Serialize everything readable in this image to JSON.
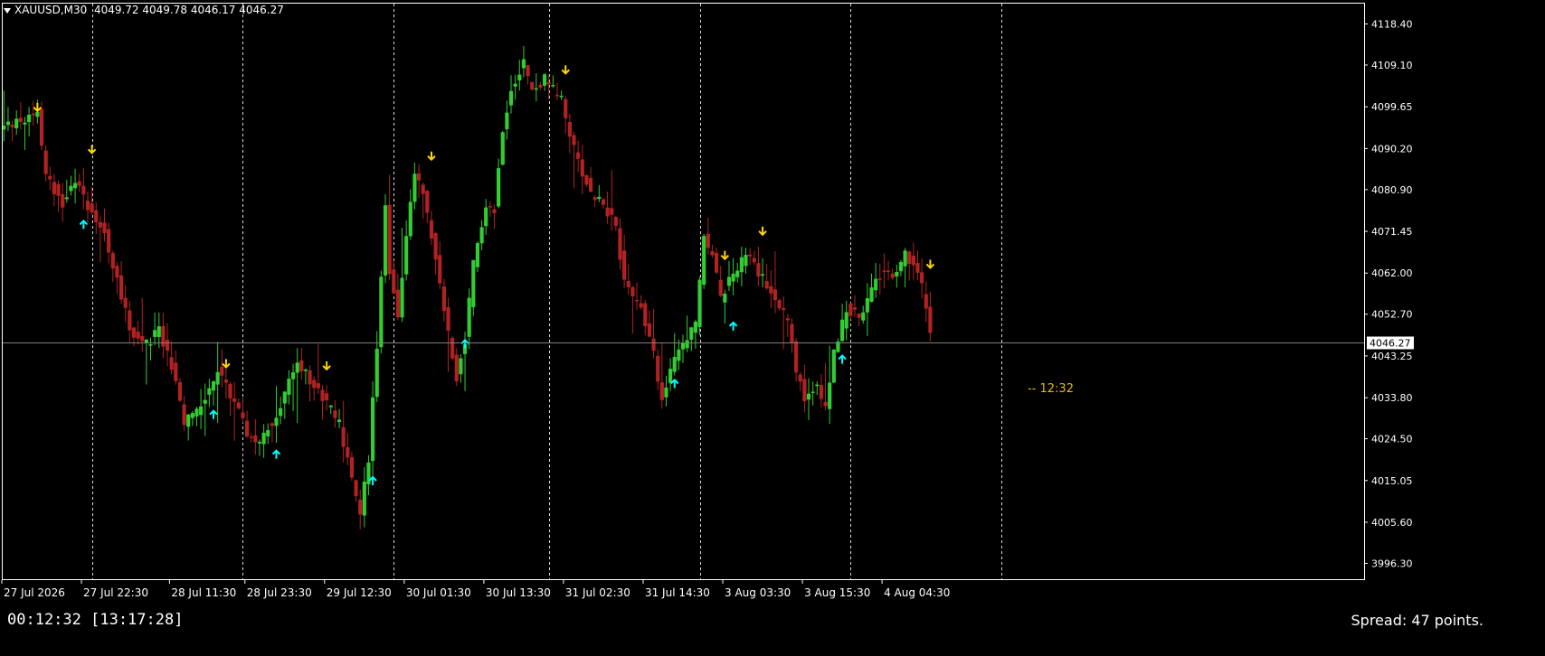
{
  "header": {
    "symbol": "XAUUSD,M30",
    "ohlc": "4049.72 4049.78 4046.17 4046.27"
  },
  "status": {
    "timer": "00:12:32 [13:17:28]",
    "spread": "Spread: 47 points.",
    "bar_countdown": "-- 12:32"
  },
  "colors": {
    "background": "#000000",
    "bull": "#32cd32",
    "bear": "#b22222",
    "grid": "#ffffff",
    "signal_sell": "#ffd700",
    "signal_buy": "#00ffff",
    "current_price_line": "#808080"
  },
  "chart_data": {
    "type": "candlestick",
    "title": "XAUUSD,M30",
    "xlabel": "",
    "ylabel": "",
    "ylim": [
      3992.5,
      4123.0
    ],
    "current_price": 4046.27,
    "current_price_label": "4046.27",
    "y_ticks": [
      "4118.40",
      "4109.10",
      "4099.65",
      "4090.20",
      "4080.90",
      "4071.45",
      "4062.00",
      "4052.70",
      "4043.25",
      "4033.80",
      "4024.50",
      "4015.05",
      "4005.60",
      "3996.30"
    ],
    "x_tick_labels": [
      "27 Jul 2026",
      "27 Jul 22:30",
      "28 Jul 11:30",
      "28 Jul 23:30",
      "29 Jul 12:30",
      "30 Jul 01:30",
      "30 Jul 13:30",
      "31 Jul 02:30",
      "31 Jul 14:30",
      "3 Aug 03:30",
      "3 Aug 15:30",
      "4 Aug 04:30"
    ],
    "x_tick_index": [
      0,
      19,
      40,
      58,
      77,
      96,
      115,
      134,
      153,
      172,
      191,
      210
    ],
    "period_separators_index": [
      21,
      57,
      93,
      130,
      166,
      202,
      238
    ],
    "total_slots": 325,
    "close_path": [
      [
        0,
        4095
      ],
      [
        8,
        4098
      ],
      [
        10,
        4084
      ],
      [
        14,
        4078
      ],
      [
        17,
        4083
      ],
      [
        19,
        4079
      ],
      [
        24,
        4071
      ],
      [
        28,
        4057
      ],
      [
        30,
        4049
      ],
      [
        34,
        4046
      ],
      [
        37,
        4049
      ],
      [
        40,
        4041
      ],
      [
        43,
        4028
      ],
      [
        47,
        4032
      ],
      [
        51,
        4040
      ],
      [
        55,
        4033
      ],
      [
        58,
        4026
      ],
      [
        61,
        4024
      ],
      [
        65,
        4030
      ],
      [
        70,
        4042
      ],
      [
        76,
        4034
      ],
      [
        80,
        4028
      ],
      [
        83,
        4015
      ],
      [
        85,
        4008
      ],
      [
        87,
        4020
      ],
      [
        89,
        4046
      ],
      [
        91,
        4078
      ],
      [
        92,
        4062
      ],
      [
        94,
        4052
      ],
      [
        96,
        4070
      ],
      [
        98,
        4084
      ],
      [
        100,
        4080
      ],
      [
        103,
        4065
      ],
      [
        106,
        4048
      ],
      [
        108,
        4038
      ],
      [
        110,
        4047
      ],
      [
        112,
        4064
      ],
      [
        115,
        4078
      ],
      [
        117,
        4076
      ],
      [
        119,
        4095
      ],
      [
        121,
        4104
      ],
      [
        124,
        4110
      ],
      [
        126,
        4103
      ],
      [
        129,
        4106
      ],
      [
        133,
        4101
      ],
      [
        136,
        4090
      ],
      [
        140,
        4080
      ],
      [
        143,
        4078
      ],
      [
        146,
        4072
      ],
      [
        148,
        4060
      ],
      [
        152,
        4054
      ],
      [
        155,
        4044
      ],
      [
        157,
        4033
      ],
      [
        159,
        4040
      ],
      [
        162,
        4046
      ],
      [
        165,
        4050
      ],
      [
        167,
        4070
      ],
      [
        169,
        4066
      ],
      [
        171,
        4056
      ],
      [
        174,
        4062
      ],
      [
        177,
        4066
      ],
      [
        180,
        4062
      ],
      [
        184,
        4057
      ],
      [
        187,
        4051
      ],
      [
        189,
        4040
      ],
      [
        191,
        4034
      ],
      [
        194,
        4036
      ],
      [
        196,
        4032
      ],
      [
        198,
        4044
      ],
      [
        201,
        4054
      ],
      [
        204,
        4052
      ],
      [
        207,
        4058
      ],
      [
        210,
        4063
      ],
      [
        212,
        4061
      ],
      [
        215,
        4066
      ],
      [
        218,
        4063
      ],
      [
        220,
        4054
      ],
      [
        221,
        4048
      ]
    ],
    "signals": [
      {
        "type": "sell",
        "index": 8,
        "price": 4099.5
      },
      {
        "type": "sell",
        "index": 21,
        "price": 4090.0
      },
      {
        "type": "buy",
        "index": 19,
        "price": 4073.0
      },
      {
        "type": "sell",
        "index": 53,
        "price": 4041.5
      },
      {
        "type": "buy",
        "index": 50,
        "price": 4030.0
      },
      {
        "type": "buy",
        "index": 65,
        "price": 4021.0
      },
      {
        "type": "sell",
        "index": 77,
        "price": 4041.0
      },
      {
        "type": "buy",
        "index": 88,
        "price": 4015.0
      },
      {
        "type": "sell",
        "index": 102,
        "price": 4088.5
      },
      {
        "type": "buy",
        "index": 110,
        "price": 4046.0
      },
      {
        "type": "sell",
        "index": 134,
        "price": 4108.0
      },
      {
        "type": "buy",
        "index": 160,
        "price": 4037.0
      },
      {
        "type": "sell",
        "index": 172,
        "price": 4066.0
      },
      {
        "type": "buy",
        "index": 174,
        "price": 4050.0
      },
      {
        "type": "sell",
        "index": 181,
        "price": 4071.5
      },
      {
        "type": "buy",
        "index": 200,
        "price": 4042.5
      },
      {
        "type": "sell",
        "index": 221,
        "price": 4064.0
      }
    ]
  }
}
